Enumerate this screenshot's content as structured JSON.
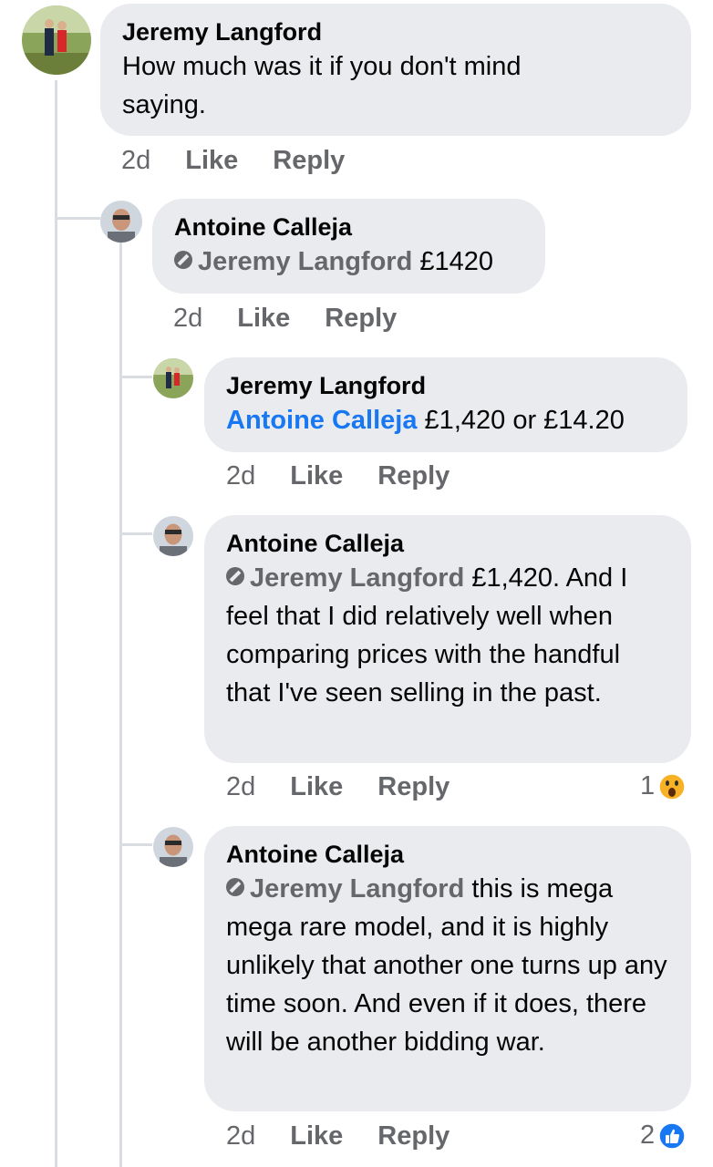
{
  "comments": [
    {
      "author": "Jeremy Langford",
      "text": "How much was it if you don't mind saying.",
      "time": "2d",
      "like": "Like",
      "reply": "Reply"
    },
    {
      "author": "Antoine Calleja",
      "mention": "Jeremy Langford",
      "text": " £1420",
      "time": "2d",
      "like": "Like",
      "reply": "Reply"
    },
    {
      "author": "Jeremy Langford",
      "mention": "Antoine Calleja",
      "text": " £1,420 or £14.20",
      "time": "2d",
      "like": "Like",
      "reply": "Reply"
    },
    {
      "author": "Antoine Calleja",
      "mention": "Jeremy Langford",
      "text": " £1,420. And I feel that I did relatively well when comparing prices with the handful that I've seen selling in the past.",
      "time": "2d",
      "like": "Like",
      "reply": "Reply",
      "reaction_count": "1",
      "reaction_icon": "wow-emoji-icon"
    },
    {
      "author": "Antoine Calleja",
      "mention": "Jeremy Langford",
      "text": " this is mega mega rare model, and it is highly unlikely that another one turns up any time soon. And even if it does,  there will be another bidding war.",
      "time": "2d",
      "like": "Like",
      "reply": "Reply",
      "reaction_count": "2",
      "reaction_icon": "like-thumb-icon"
    }
  ],
  "colors": {
    "bubble": "#e9ebee",
    "mention_blue": "#1877f2",
    "meta_gray": "#65676b",
    "thread_line": "#d9dce1"
  }
}
